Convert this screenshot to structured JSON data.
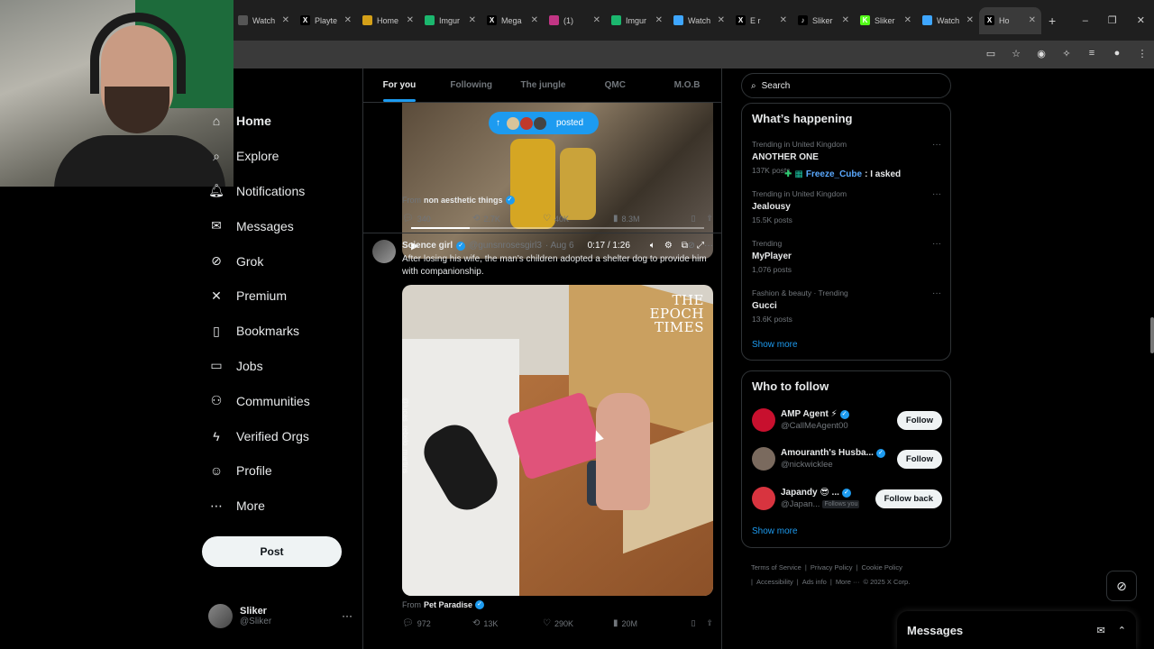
{
  "browser": {
    "tabs": [
      {
        "label": "Watch",
        "color": "#555555",
        "glyph": ""
      },
      {
        "label": "Playte",
        "color": "#000000",
        "glyph": "X"
      },
      {
        "label": "Home",
        "color": "#d4a018",
        "glyph": ""
      },
      {
        "label": "Imgur",
        "color": "#1bb76e",
        "glyph": ""
      },
      {
        "label": "Mega",
        "color": "#000000",
        "glyph": "X"
      },
      {
        "label": "(1)",
        "color": "#c13584",
        "glyph": ""
      },
      {
        "label": "Imgur",
        "color": "#1bb76e",
        "glyph": ""
      },
      {
        "label": "Watch",
        "color": "#3ea6ff",
        "glyph": ""
      },
      {
        "label": "E r",
        "color": "#000000",
        "glyph": "X"
      },
      {
        "label": "Sliker",
        "color": "#000000",
        "glyph": "♪"
      },
      {
        "label": "Sliker",
        "color": "#53fc18",
        "glyph": "K"
      },
      {
        "label": "Watch",
        "color": "#3ea6ff",
        "glyph": ""
      },
      {
        "label": "Ho",
        "color": "#000000",
        "glyph": "X"
      }
    ],
    "active_tab_index": 12,
    "new_tab": "+",
    "window_controls": [
      "–",
      "❐",
      "✕"
    ]
  },
  "nav": {
    "items": [
      {
        "label": "Home",
        "icon": "home-icon",
        "glyph": "⌂"
      },
      {
        "label": "Explore",
        "icon": "search-icon",
        "glyph": "⌕"
      },
      {
        "label": "Notifications",
        "icon": "bell-icon",
        "glyph": "🔔︎"
      },
      {
        "label": "Messages",
        "icon": "envelope-icon",
        "glyph": "✉"
      },
      {
        "label": "Grok",
        "icon": "grok-icon",
        "glyph": "⊘"
      },
      {
        "label": "Premium",
        "icon": "x-logo-icon",
        "glyph": "✕"
      },
      {
        "label": "Bookmarks",
        "icon": "bookmark-icon",
        "glyph": "▯"
      },
      {
        "label": "Jobs",
        "icon": "briefcase-icon",
        "glyph": "▭"
      },
      {
        "label": "Communities",
        "icon": "people-icon",
        "glyph": "⚇"
      },
      {
        "label": "Verified Orgs",
        "icon": "lightning-icon",
        "glyph": "ϟ"
      },
      {
        "label": "Profile",
        "icon": "person-icon",
        "glyph": "☺"
      },
      {
        "label": "More",
        "icon": "more-circle-icon",
        "glyph": "⋯"
      }
    ],
    "post_label": "Post",
    "account": {
      "name": "Sliker",
      "handle": "@Sliker"
    }
  },
  "feed": {
    "tabs": [
      "For you",
      "Following",
      "The jungle",
      "QMC",
      "M.O.B"
    ],
    "posted_pill": "posted",
    "tweet1": {
      "video_time": "0:17 / 1:26",
      "video_progress": 0.2,
      "from_label": "From",
      "from_source": "non aesthetic things",
      "replies": "340",
      "reposts": "2.7K",
      "likes": "40K",
      "views": "8.3M"
    },
    "tweet2": {
      "name": "Science girl",
      "handle": "@gunsnrosesgirl3",
      "date": "· Aug 6",
      "text": "After losing his wife, the man's children adopted a shelter dog to provide him with companionship.",
      "watermark_line1": "THE",
      "watermark_line2": "EPOCH",
      "watermark_line3": "TIMES",
      "side_watermark": "@lucas_rebelo_martins",
      "from_label": "From",
      "from_source": "Pet Paradise",
      "replies": "972",
      "reposts": "13K",
      "likes": "290K",
      "views": "20M"
    }
  },
  "sidebar": {
    "search_placeholder": "Search",
    "happening_title": "What’s happening",
    "trends": [
      {
        "context": "Trending in United Kingdom",
        "title": "ANOTHER ONE",
        "count": "137K posts"
      },
      {
        "context": "Trending in United Kingdom",
        "title": "Jealousy",
        "count": "15.5K posts"
      },
      {
        "context": "Trending",
        "title": "MyPlayer",
        "count": "1,076 posts"
      },
      {
        "context": "Fashion & beauty · Trending",
        "title": "Gucci",
        "count": "13.6K posts"
      }
    ],
    "show_more": "Show more",
    "chat_overlay": {
      "user": "Freeze_Cube",
      "message": ": I asked"
    },
    "who_to_follow_title": "Who to follow",
    "suggestions": [
      {
        "name": "AMP Agent ⚡",
        "handle": "@CallMeAgent00",
        "button": "Follow",
        "follows_you": "",
        "avatar_color": "#c8102e"
      },
      {
        "name": "Amouranth's Husba...",
        "handle": "@nickwicklee",
        "button": "Follow",
        "follows_you": "",
        "avatar_color": "#7a6a5e"
      },
      {
        "name": "Japandy 😎 ...",
        "handle": "@Japan...",
        "button": "Follow back",
        "follows_you": "Follows you",
        "avatar_color": "#d8343f"
      }
    ],
    "show_more_2": "Show more",
    "footer": [
      "Terms of Service",
      "|",
      "Privacy Policy",
      "|",
      "Cookie Policy",
      "|",
      "Accessibility",
      "|",
      "Ads info",
      "|",
      "More ···",
      "© 2025 X Corp."
    ]
  },
  "messages_dock": {
    "title": "Messages"
  }
}
